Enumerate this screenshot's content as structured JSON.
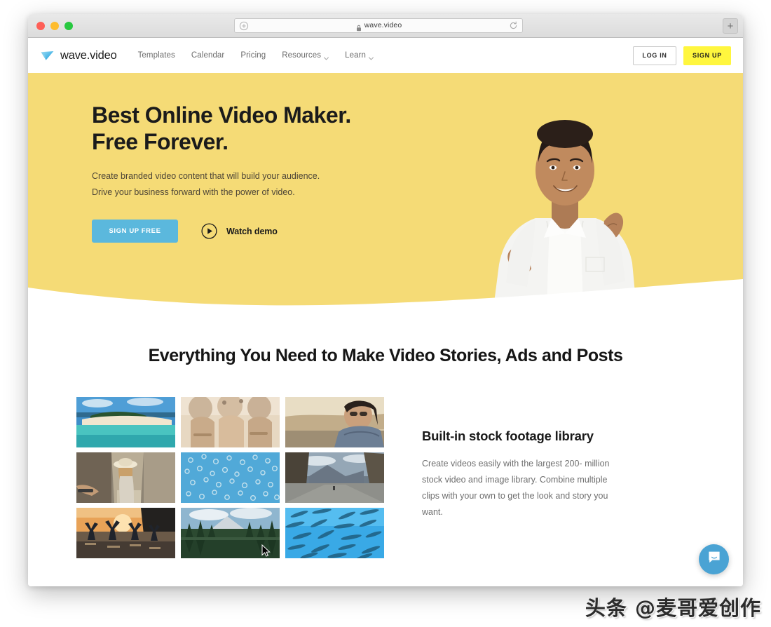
{
  "browser": {
    "traffic_lights": [
      "close",
      "minimize",
      "maximize"
    ],
    "omnibox": {
      "url": "wave.video",
      "left_icon": "circled-plus-icon",
      "lock_icon": "lock-icon",
      "reload_icon": "reload-icon"
    },
    "new_tab_label": "+"
  },
  "nav": {
    "brand": "wave.video",
    "links": [
      {
        "label": "Templates",
        "has_caret": false
      },
      {
        "label": "Calendar",
        "has_caret": false
      },
      {
        "label": "Pricing",
        "has_caret": false
      },
      {
        "label": "Resources",
        "has_caret": true
      },
      {
        "label": "Learn",
        "has_caret": true
      }
    ],
    "login_label": "LOG IN",
    "signup_label": "SIGN UP"
  },
  "hero": {
    "title_line1": "Best Online Video Maker.",
    "title_line2": "Free Forever.",
    "sub_line1": "Create branded video content that will build your audience.",
    "sub_line2": "Drive your business forward with the power of video.",
    "cta_primary": "SIGN UP FREE",
    "cta_secondary": "Watch demo",
    "play_icon": "play-circle-icon",
    "background_color": "#f5db76",
    "cta_primary_color": "#5bb8dd"
  },
  "features": {
    "heading_line1": "Everything You Need to Make Video Stories,",
    "heading_line2": "Ads and Posts",
    "title_line1": "Built-in stock footage",
    "title_line2": "library",
    "body_line1": "Create videos easily with the largest 200-",
    "body_line2": "million stock video and image library.",
    "body_line3": "Combine multiple clips with your own to get",
    "body_line4": "the look and story you want.",
    "thumbnails": [
      {
        "name": "tropical-beach-island"
      },
      {
        "name": "friends-hands-confetti"
      },
      {
        "name": "woman-sunglasses-car-window"
      },
      {
        "name": "woman-hat-walking-street"
      },
      {
        "name": "jellyfish-blue-water"
      },
      {
        "name": "mountain-road-landscape"
      },
      {
        "name": "friends-sunset-water-celebration"
      },
      {
        "name": "forest-lake-reflection"
      },
      {
        "name": "school-of-fish-underwater"
      }
    ],
    "cursor_on_thumbnail_index": 4
  },
  "chat": {
    "icon": "chat-bubble-icon",
    "color": "#4aa3d4"
  },
  "watermark": {
    "text": "头条 @麦哥爱创作"
  }
}
